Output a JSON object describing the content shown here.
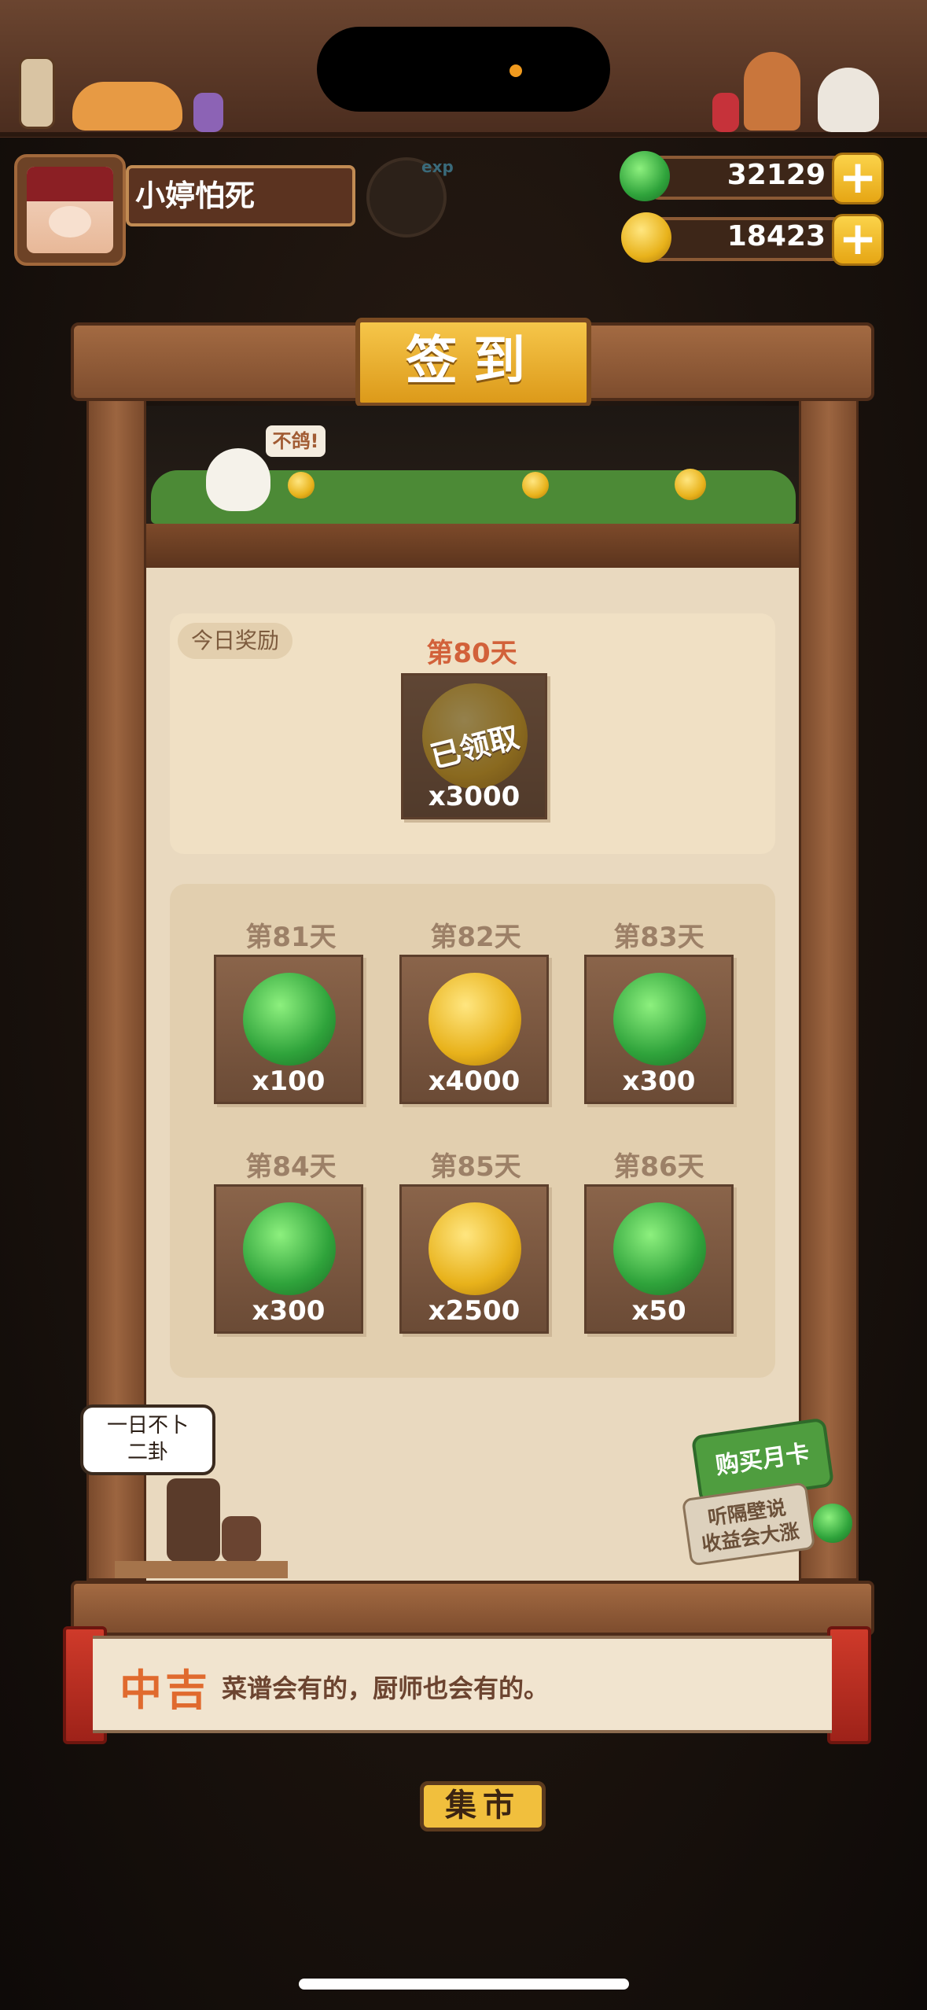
{
  "profile": {
    "name": "小婷怕死",
    "exp_tag": "exp"
  },
  "currencies": [
    {
      "name": "jade",
      "value": "32129",
      "icon": "jade-icon",
      "add": "+"
    },
    {
      "name": "coin",
      "value": "18423",
      "icon": "coin-icon",
      "add": "+"
    }
  ],
  "signin": {
    "title": "签到",
    "bird_bubble": "不鸽!",
    "today_tag": "今日奖励",
    "today_day": "第80天",
    "today_amount": "x3000",
    "today_status": "已领取",
    "days": [
      {
        "label": "第81天",
        "amount": "x100",
        "icon": "jade-icon"
      },
      {
        "label": "第82天",
        "amount": "x4000",
        "icon": "coin-icon"
      },
      {
        "label": "第83天",
        "amount": "x300",
        "icon": "jade-icon"
      },
      {
        "label": "第84天",
        "amount": "x300",
        "icon": "jade-icon"
      },
      {
        "label": "第85天",
        "amount": "x2500",
        "icon": "coin-icon"
      },
      {
        "label": "第86天",
        "amount": "x50",
        "icon": "jade-icon"
      }
    ]
  },
  "speech_bubble": {
    "line1": "一日不卜",
    "line2": "二卦"
  },
  "monthly_card": {
    "button": "购买月卡",
    "sign_line1": "听隔壁说",
    "sign_line2": "收益会大涨"
  },
  "fortune": {
    "level": "中吉",
    "text": "菜谱会有的，厨师也会有的。"
  },
  "background": {
    "market_sign": "集市"
  },
  "colors": {
    "accent_gold": "#f6c64a",
    "today_red": "#d2613a",
    "fortune_orange": "#e06a2e"
  }
}
